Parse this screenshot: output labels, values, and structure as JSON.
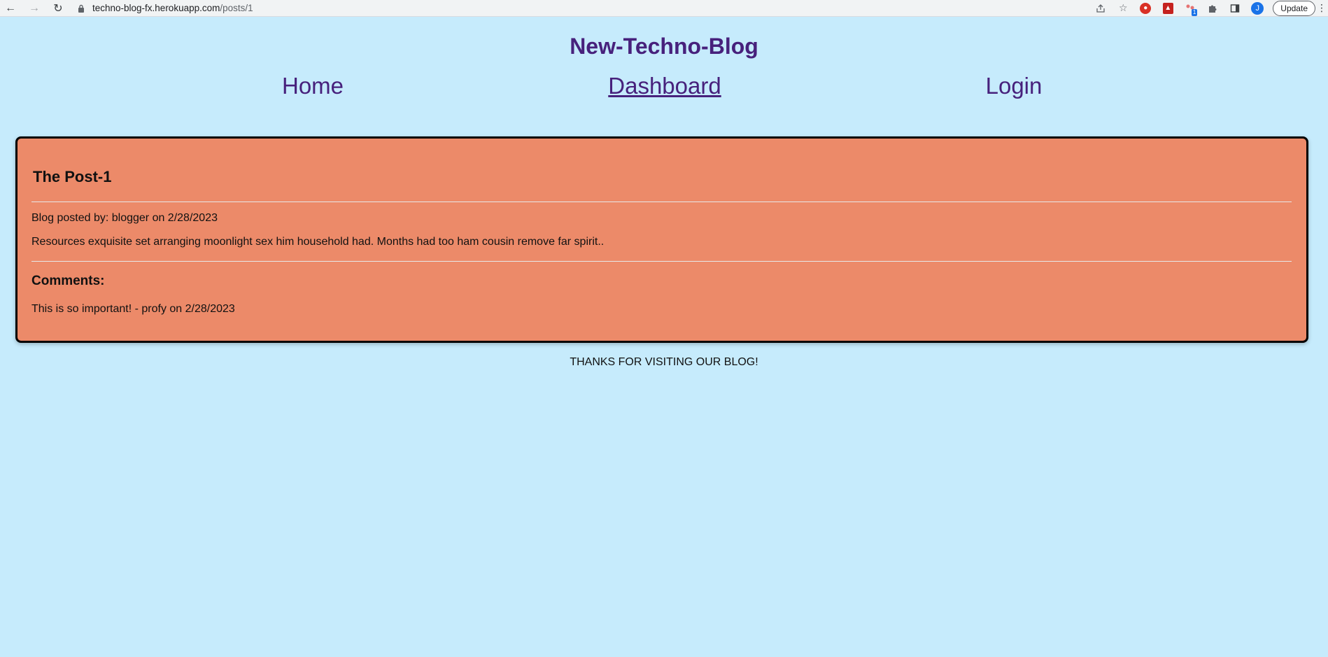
{
  "browser": {
    "url_host": "techno-blog-fx.herokuapp.com",
    "url_path": "/posts/1",
    "avatar_letter": "J",
    "update_label": "Update",
    "extension_badge": "1",
    "icons": [
      "back-arrow-icon",
      "forward-arrow-icon",
      "reload-icon",
      "lock-icon",
      "share-icon",
      "star-icon",
      "extension-icon",
      "pdf-icon",
      "puzzle-icon",
      "sidebar-icon",
      "kebab-menu-icon"
    ]
  },
  "site": {
    "title": "New-Techno-Blog",
    "colors": {
      "background": "#c6ebfc",
      "title": "#47217c",
      "card": "#ec8a69"
    }
  },
  "nav": {
    "home": "Home",
    "dashboard": "Dashboard",
    "login": "Login"
  },
  "post": {
    "title": "The Post-1",
    "meta": "Blog posted by: blogger on 2/28/2023",
    "body": "Resources exquisite set arranging moonlight sex him household had. Months had too ham cousin remove far spirit..",
    "comments_heading": "Comments:",
    "comments": [
      {
        "text": "This is so important! - profy on 2/28/2023"
      }
    ]
  },
  "footer": {
    "text": "THANKS FOR VISITING OUR BLOG!"
  }
}
